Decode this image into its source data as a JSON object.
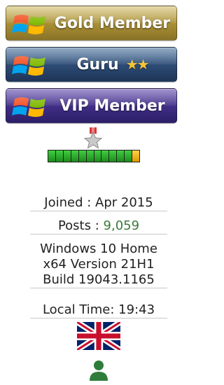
{
  "badges": [
    {
      "label": "Gold Member"
    },
    {
      "label": "Guru",
      "stars": "★★"
    },
    {
      "label": "VIP Member"
    }
  ],
  "reputation": {
    "segments_total": 12,
    "segments_filled": 11
  },
  "user_info": {
    "joined": "Joined : Apr 2015",
    "posts_label": "Posts :",
    "posts_count": "9,059",
    "system_line1": "Windows 10 Home",
    "system_line2": "x64 Version 21H1",
    "system_line3": "Build 19043.1165",
    "local_time": "Local Time: 19:43"
  },
  "icons": {
    "badge_logo": "windows-logo-icon",
    "rank": "medal-star-icon",
    "flag": "uk-flag-icon",
    "profile": "user-icon"
  },
  "colors": {
    "posts_count": "#3a7a3a",
    "profile_icon": "#2f7d3a",
    "rep_filled": "#2fbf2f",
    "rep_last": "#f0b400"
  }
}
